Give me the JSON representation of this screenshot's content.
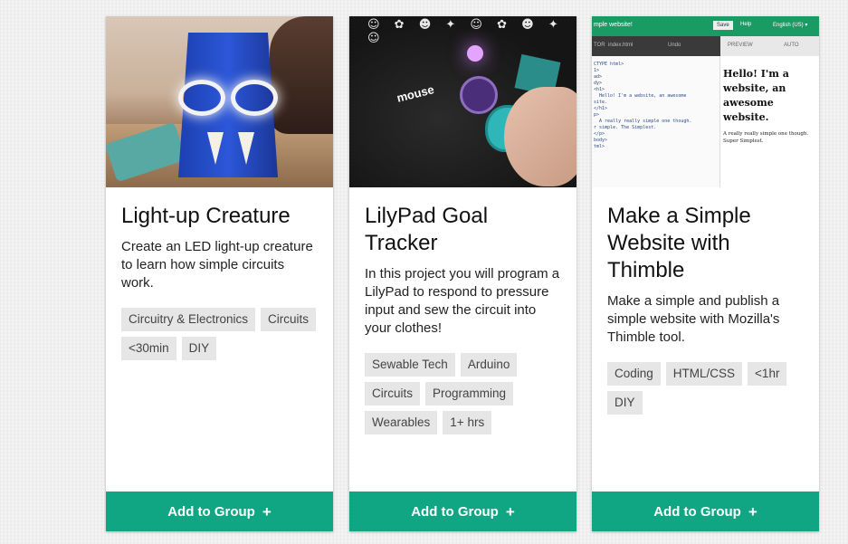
{
  "cards": [
    {
      "title": "Light-up Creature",
      "description": "Create an LED light-up creature to learn how simple circuits work.",
      "tags": [
        "Circuitry & Electronics",
        "Circuits",
        "<30min",
        "DIY"
      ],
      "button_label": "Add to Group",
      "button_icon": "+"
    },
    {
      "title": "LilyPad Goal Tracker",
      "description": "In this project you will program a LilyPad to respond to pressure input and sew the circuit into your clothes!",
      "tags": [
        "Sewable Tech",
        "Arduino",
        "Circuits",
        "Programming",
        "Wearables",
        "1+ hrs"
      ],
      "button_label": "Add to Group",
      "button_icon": "+",
      "image_text": {
        "logo": "mouse"
      }
    },
    {
      "title": "Make a Simple Website with Thimble",
      "description": "Make a simple and publish a simple website with Mozilla's Thimble tool.",
      "tags": [
        "Coding",
        "HTML/CSS",
        "<1hr",
        "DIY"
      ],
      "button_label": "Add to Group",
      "button_icon": "+",
      "image_text": {
        "project_name": "mple website!",
        "save": "Save",
        "help": "Help",
        "language": "English (US) ▾",
        "editor_label": "TOR",
        "file_label": "index.html",
        "undo": "Undo",
        "preview_label": "PREVIEW",
        "auto": "AUTO",
        "code": "CTYPE html>\n1>\nad>\ndy>\n<h1>\n  Hello! I'm a website, an awesome\nsite.\n</h1>\np>\n  A really really simple one though.\nr simple. The Simplest.\n</p>\nbody>\ntml>",
        "preview_heading": "Hello! I'm a website, an awesome website.",
        "preview_text": "A really really simple one though. Super Simplest."
      }
    }
  ],
  "colors": {
    "button": "#11a683",
    "tag_bg": "#e6e6e6",
    "thimble_green": "#1b9b64"
  }
}
